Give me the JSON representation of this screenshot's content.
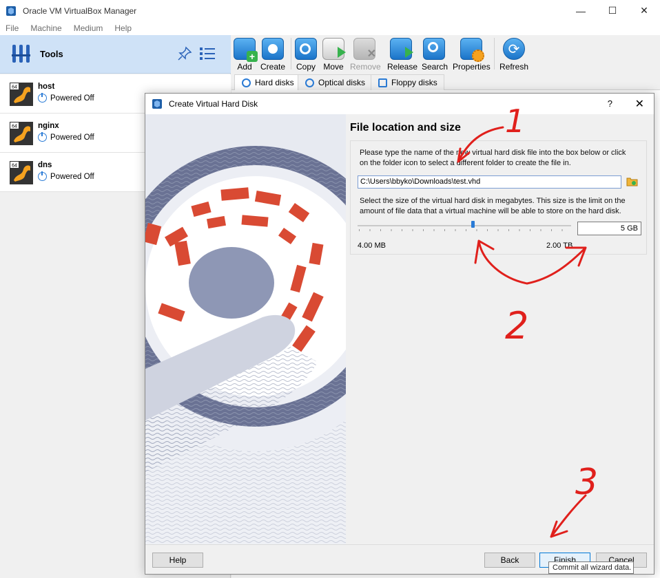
{
  "window": {
    "title": "Oracle VM VirtualBox Manager",
    "controls": [
      "—",
      "☐",
      "✕"
    ]
  },
  "menu": [
    "File",
    "Machine",
    "Medium",
    "Help"
  ],
  "tools": {
    "label": "Tools"
  },
  "vms": [
    {
      "name": "host",
      "state": "Powered Off",
      "badge": "64"
    },
    {
      "name": "nginx",
      "state": "Powered Off",
      "badge": "64"
    },
    {
      "name": "dns",
      "state": "Powered Off",
      "badge": "64"
    }
  ],
  "toolbar": {
    "buttons": [
      {
        "label": "Add",
        "icon": "add-icon",
        "enabled": true
      },
      {
        "label": "Create",
        "icon": "create-icon",
        "enabled": true
      },
      {
        "label": "Copy",
        "icon": "copy-icon",
        "enabled": true
      },
      {
        "label": "Move",
        "icon": "move-icon",
        "enabled": true
      },
      {
        "label": "Remove",
        "icon": "remove-icon",
        "enabled": false
      },
      {
        "label": "Release",
        "icon": "release-icon",
        "enabled": true
      },
      {
        "label": "Search",
        "icon": "search-icon",
        "enabled": true
      },
      {
        "label": "Properties",
        "icon": "properties-icon",
        "enabled": true
      },
      {
        "label": "Refresh",
        "icon": "refresh-icon",
        "enabled": true
      }
    ]
  },
  "tabs": [
    {
      "label": "Hard disks",
      "active": true
    },
    {
      "label": "Optical disks",
      "active": false
    },
    {
      "label": "Floppy disks",
      "active": false
    }
  ],
  "dialog": {
    "title": "Create Virtual Hard Disk",
    "help_glyph": "?",
    "close_glyph": "✕",
    "heading": "File location and size",
    "location_desc": "Please type the name of the new virtual hard disk file into the box below or click on the folder icon to select a different folder to create the file in.",
    "path_value": "C:\\Users\\bbyko\\Downloads\\test.vhd",
    "size_desc": "Select the size of the virtual hard disk in megabytes. This size is the limit on the amount of file data that a virtual machine will be able to store on the hard disk.",
    "size_value": "5 GB",
    "slider_position": 0.54,
    "min_label": "4.00 MB",
    "max_label": "2.00 TB",
    "buttons": {
      "help": "Help",
      "back": "Back",
      "finish": "Finish",
      "cancel": "Cancel"
    },
    "tooltip": "Commit all wizard data."
  },
  "annotations": [
    "1",
    "2",
    "3"
  ],
  "colors": {
    "accent": "#2a7bd6",
    "annotation": "#e0201c",
    "selection": "#cfe2f7"
  }
}
